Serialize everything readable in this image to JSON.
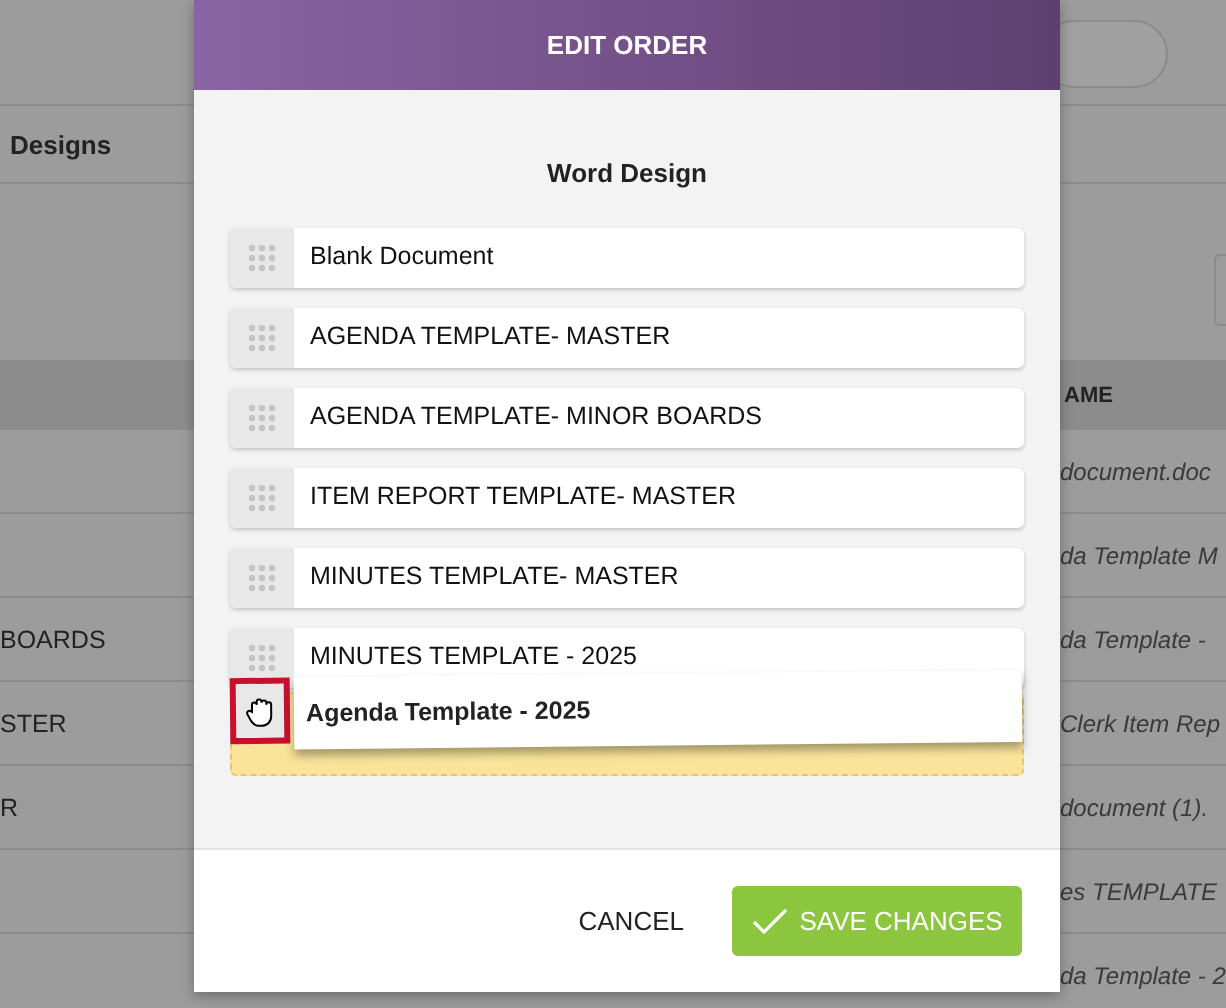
{
  "background": {
    "tab_label": "Designs",
    "column_header": "AME",
    "rows": [
      {
        "name": "document.doc"
      },
      {
        "name": "da Template M"
      },
      {
        "title": "BOARDS",
        "name": "da Template -"
      },
      {
        "title": "STER",
        "name": "Clerk Item Rep"
      },
      {
        "title": "R",
        "name": "document (1)."
      },
      {
        "name": "es TEMPLATE"
      },
      {
        "name": "da Template - 2"
      }
    ]
  },
  "modal": {
    "title": "EDIT ORDER",
    "heading": "Word Design",
    "items": [
      "Blank Document",
      "AGENDA TEMPLATE- MASTER",
      "AGENDA TEMPLATE- MINOR BOARDS",
      "ITEM REPORT TEMPLATE- MASTER",
      "MINUTES TEMPLATE- MASTER",
      "MINUTES TEMPLATE - 2025"
    ],
    "dragged": {
      "label": "Agenda Template - 2025"
    },
    "buttons": {
      "cancel": "CANCEL",
      "save": "SAVE CHANGES"
    }
  }
}
